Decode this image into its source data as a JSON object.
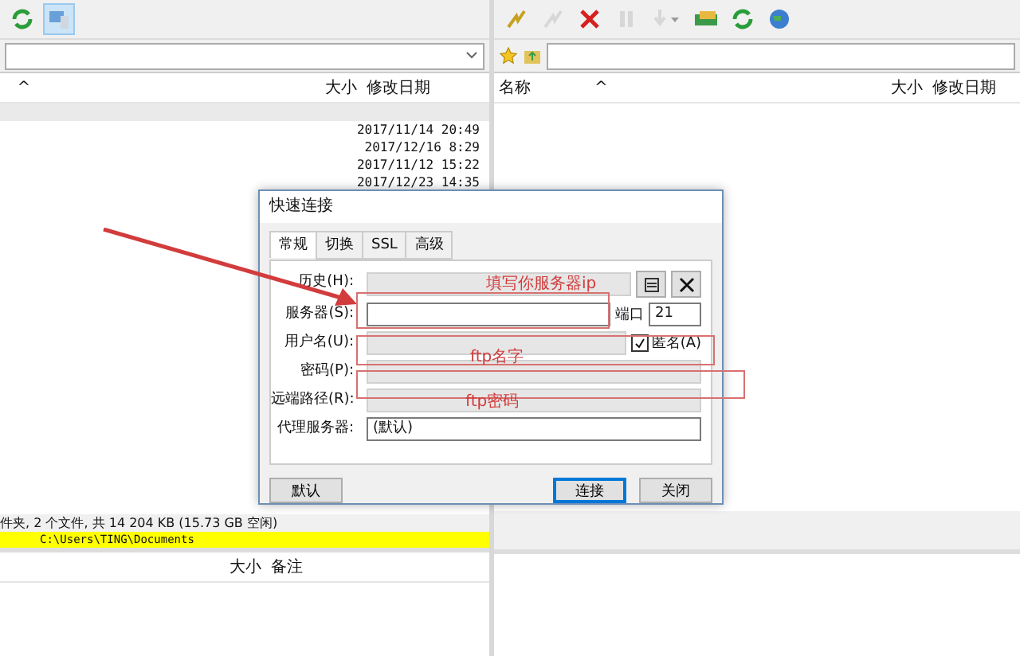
{
  "left_toolbar": [
    {
      "kind": "refresh",
      "selected": false
    },
    {
      "kind": "computer",
      "selected": true
    }
  ],
  "right_toolbar": [
    {
      "kind": "connect",
      "disabled": false
    },
    {
      "kind": "disconnect",
      "disabled": true
    },
    {
      "kind": "stop",
      "disabled": false
    },
    {
      "kind": "pause",
      "disabled": true
    },
    {
      "kind": "download",
      "disabled": true
    },
    {
      "kind": "transfer",
      "disabled": false
    },
    {
      "kind": "refresh",
      "disabled": false
    },
    {
      "kind": "globe",
      "disabled": false
    }
  ],
  "left_pane": {
    "columns": [
      "^",
      "大小",
      "修改日期"
    ],
    "rows": [
      {
        "date": "",
        "selected": true
      },
      {
        "date": "2017/11/14 20:49",
        "selected": false
      },
      {
        "date": "2017/12/16 8:29",
        "selected": false
      },
      {
        "date": "2017/11/12 15:22",
        "selected": false
      },
      {
        "date": "2017/12/23 14:35",
        "selected": false
      }
    ],
    "status": "件夹, 2 个文件, 共 14 204 KB (15.73 GB 空闲)",
    "path": "C:\\Users\\TING\\Documents",
    "lower_columns": [
      "大小",
      "备注"
    ]
  },
  "right_pane": {
    "columns": [
      "名称",
      "^",
      "大小",
      "修改日期"
    ]
  },
  "dialog": {
    "title": "快速连接",
    "tabs": [
      {
        "label": "常规",
        "selected": true
      },
      {
        "label": "切换",
        "selected": false
      },
      {
        "label": "SSL",
        "selected": false
      },
      {
        "label": "高级",
        "selected": false
      }
    ],
    "history_label": "历史(H):",
    "server_label": "服务器(S):",
    "port_label": "端口",
    "port": "21",
    "user_label": "用户名(U):",
    "anonymous": {
      "label": "匿名(A)",
      "checked": true
    },
    "password_label": "密码(P):",
    "remote_label": "远端路径(R):",
    "proxy_label": "代理服务器:",
    "proxy": "(默认)",
    "buttons": [
      {
        "label": "默认",
        "default": false
      },
      {
        "label": "连接",
        "default": true
      },
      {
        "label": "关闭",
        "default": false
      }
    ]
  },
  "annotations": [
    "填写你服务器ip",
    "ftp名字",
    "ftp密码"
  ]
}
